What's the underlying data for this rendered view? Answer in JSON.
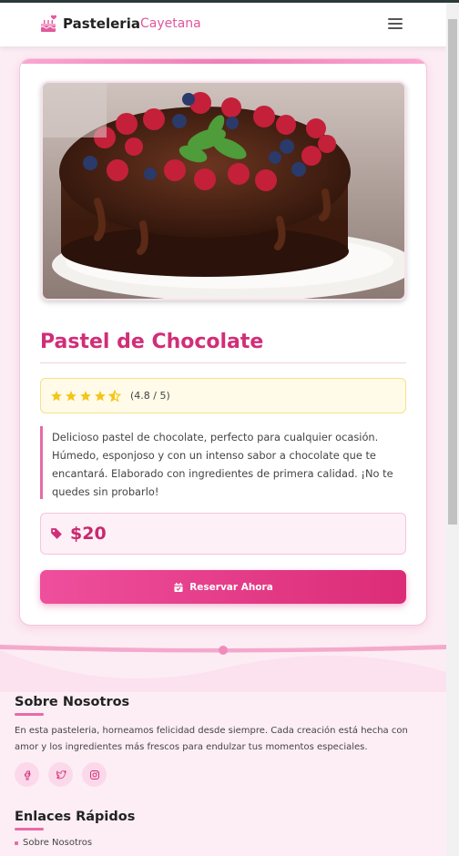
{
  "header": {
    "brand_bold": "Pasteleria",
    "brand_light": "Cayetana",
    "menu_icon": "hamburger-icon"
  },
  "product": {
    "title": "Pastel de Chocolate",
    "rating_value": 4.5,
    "rating_text": "(4.8 / 5)",
    "description": "Delicioso pastel de chocolate, perfecto para cualquier ocasión. Húmedo, esponjoso y con un intenso sabor a chocolate que te encantará. Elaborado con ingredientes de primera calidad. ¡No te quedes sin probarlo!",
    "price": "$20",
    "reserve_label": "Reservar Ahora"
  },
  "footer": {
    "about_title": "Sobre Nosotros",
    "about_text": "En esta pasteleria, horneamos felicidad desde siempre. Cada creación está hecha con amor y los ingredientes más frescos para endulzar tus momentos especiales.",
    "socials": [
      "facebook-icon",
      "twitter-icon",
      "instagram-icon"
    ],
    "links_title": "Enlaces Rápidos",
    "links": [
      "Sobre Nosotros"
    ]
  },
  "colors": {
    "accent": "#d12e78",
    "button_start": "#ee4f9c",
    "button_end": "#dc2c77",
    "star": "#f5c518"
  }
}
